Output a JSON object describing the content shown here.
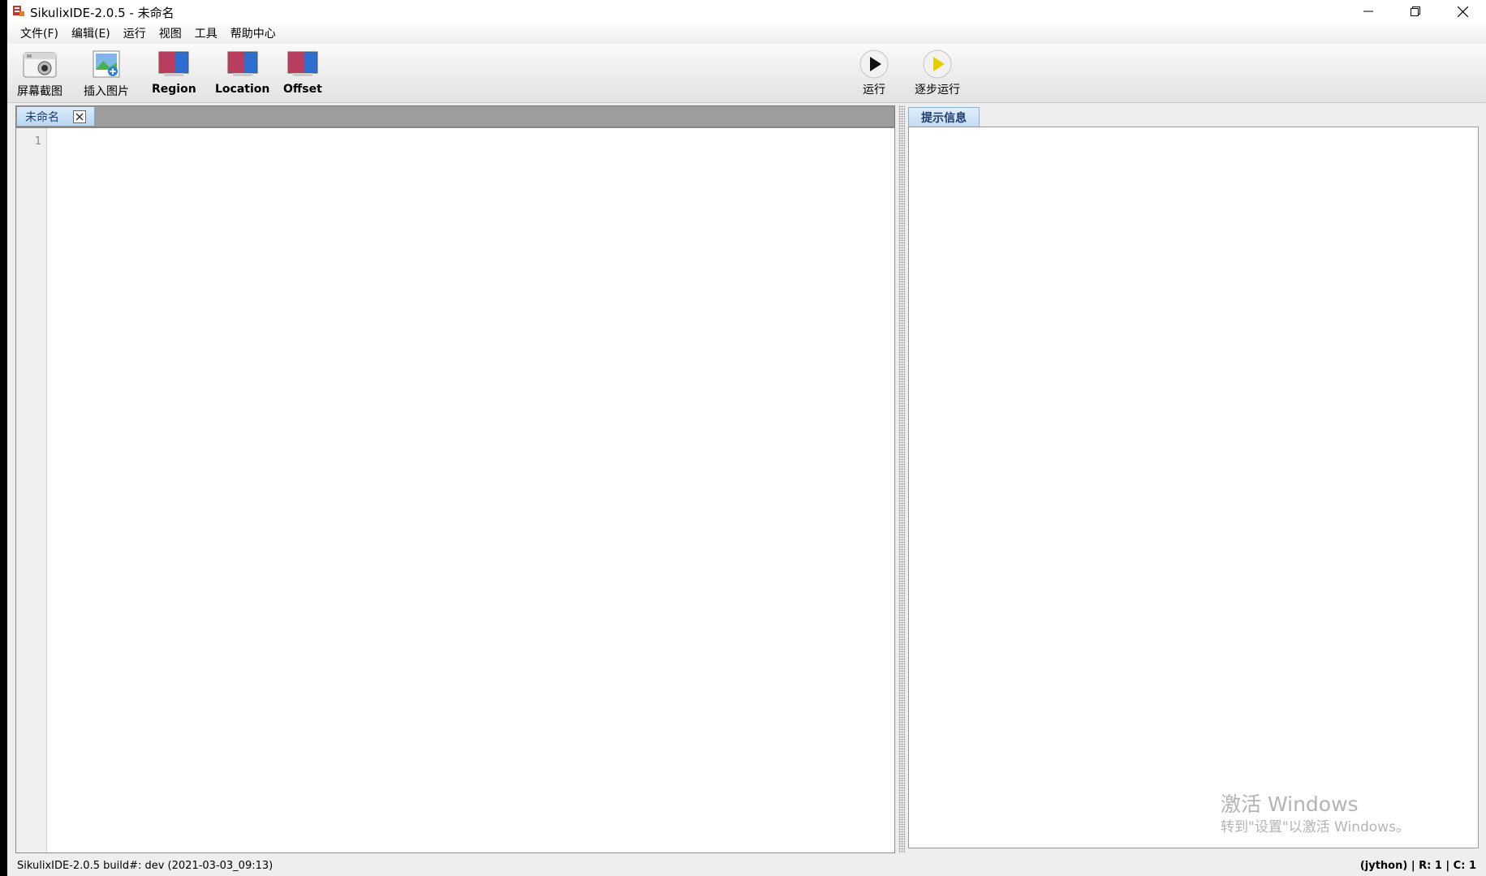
{
  "window": {
    "title": "SikulixIDE-2.0.5 - 未命名"
  },
  "menu": {
    "items": [
      "文件(F)",
      "编辑(E)",
      "运行",
      "视图",
      "工具",
      "帮助中心"
    ]
  },
  "toolbar": {
    "screenshot_label": "屏幕截图",
    "insert_image_label": "插入图片",
    "region_label": "Region",
    "location_label": "Location",
    "offset_label": "Offset",
    "run_label": "运行",
    "step_run_label": "逐步运行"
  },
  "editor": {
    "tab_label": "未命名",
    "line_numbers": [
      "1"
    ]
  },
  "message_panel": {
    "tab_label": "提示信息"
  },
  "watermark": {
    "title": "激活 Windows",
    "subtitle": "转到\"设置\"以激活 Windows。"
  },
  "status": {
    "build": "SikulixIDE-2.0.5 build#: dev (2021-03-03_09:13)",
    "right": "(jython) | R: 1 | C: 1"
  },
  "colors": {
    "accent_tab": "#b8d7f3",
    "run_icon": "#111111",
    "step_icon": "#e6cc00"
  }
}
